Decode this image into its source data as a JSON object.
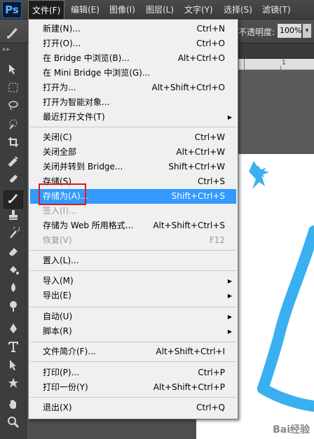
{
  "app": {
    "logo": "Ps"
  },
  "menubar": {
    "items": [
      "文件(F)",
      "编辑(E)",
      "图像(I)",
      "图层(L)",
      "文字(Y)",
      "选择(S)",
      "滤镜(T)"
    ]
  },
  "options": {
    "opacity_label": "不透明度:",
    "opacity_value": "100%",
    "dropdown_arrow": "▾"
  },
  "ruler": {
    "label": "1"
  },
  "watermark": "Bai经验",
  "file_menu": {
    "items": [
      {
        "label": "新建(N)...",
        "shortcut": "Ctrl+N"
      },
      {
        "label": "打开(O)...",
        "shortcut": "Ctrl+O"
      },
      {
        "label": "在 Bridge 中浏览(B)...",
        "shortcut": "Alt+Ctrl+O"
      },
      {
        "label": "在 Mini Bridge 中浏览(G)...",
        "shortcut": ""
      },
      {
        "label": "打开为...",
        "shortcut": "Alt+Shift+Ctrl+O"
      },
      {
        "label": "打开为智能对象...",
        "shortcut": ""
      },
      {
        "label": "最近打开文件(T)",
        "shortcut": "",
        "submenu": true
      },
      {
        "label": "关闭(C)",
        "shortcut": "Ctrl+W"
      },
      {
        "label": "关闭全部",
        "shortcut": "Alt+Ctrl+W"
      },
      {
        "label": "关闭并转到 Bridge...",
        "shortcut": "Shift+Ctrl+W"
      },
      {
        "label": "存储(S)",
        "shortcut": "Ctrl+S"
      },
      {
        "label": "存储为(A)...",
        "shortcut": "Shift+Ctrl+S",
        "highlighted": true
      },
      {
        "label": "签入(I)...",
        "shortcut": "",
        "disabled": true
      },
      {
        "label": "存储为 Web 所用格式...",
        "shortcut": "Alt+Shift+Ctrl+S"
      },
      {
        "label": "恢复(V)",
        "shortcut": "F12",
        "disabled": true
      },
      {
        "label": "置入(L)...",
        "shortcut": ""
      },
      {
        "label": "导入(M)",
        "shortcut": "",
        "submenu": true
      },
      {
        "label": "导出(E)",
        "shortcut": "",
        "submenu": true
      },
      {
        "label": "自动(U)",
        "shortcut": "",
        "submenu": true
      },
      {
        "label": "脚本(R)",
        "shortcut": "",
        "submenu": true
      },
      {
        "label": "文件简介(F)...",
        "shortcut": "Alt+Shift+Ctrl+I"
      },
      {
        "label": "打印(P)...",
        "shortcut": "Ctrl+P"
      },
      {
        "label": "打印一份(Y)",
        "shortcut": "Alt+Shift+Ctrl+P"
      },
      {
        "label": "退出(X)",
        "shortcut": "Ctrl+Q"
      }
    ]
  },
  "colors": {
    "highlight": "#3399ff",
    "stroke": "#3ab0f0",
    "annotation": "#e01818"
  }
}
